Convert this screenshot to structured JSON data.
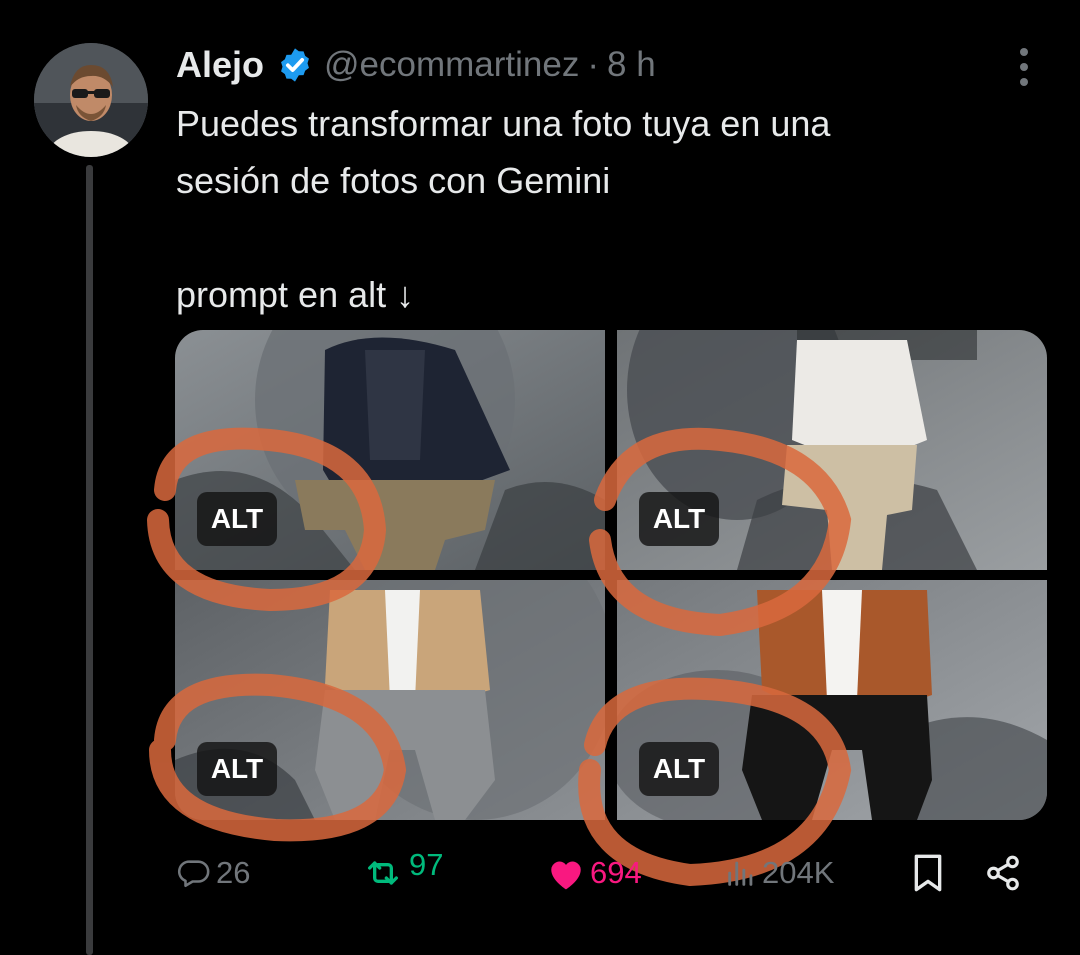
{
  "top_partial_text": "",
  "author": {
    "name": "Alejo",
    "verified": true,
    "handle": "@ecommartinez",
    "separator": "·",
    "time": "8 h"
  },
  "tweet": {
    "line1": "Puedes transformar una foto tuya en una",
    "line2": "sesión de fotos con Gemini",
    "line3": "prompt en alt ↓"
  },
  "media": [
    {
      "alt_badge": "ALT",
      "jacket": "navy puffer jacket",
      "color": "#1e2433"
    },
    {
      "alt_badge": "ALT",
      "jacket": "white shirt",
      "color": "#eceae6"
    },
    {
      "alt_badge": "ALT",
      "jacket": "beige leather jacket",
      "color": "#c9a57a"
    },
    {
      "alt_badge": "ALT",
      "jacket": "brown leather jacket",
      "color": "#a9582b"
    }
  ],
  "actions": {
    "replies": "26",
    "reposts": "97",
    "likes": "694",
    "views": "204K"
  },
  "colors": {
    "background": "#000000",
    "text": "#e7e9ea",
    "secondary": "#71767b",
    "verified": "#1d9bf0",
    "repost": "#00ba7c",
    "like": "#f91880",
    "annotation_circle": "#d9693d"
  }
}
